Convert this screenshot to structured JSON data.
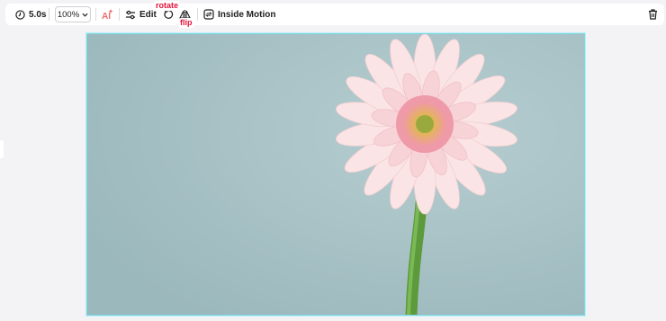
{
  "toolbar": {
    "duration_label": "5.0s",
    "zoom_value": "100%",
    "edit_label": "Edit",
    "rotate_tag": "rotate",
    "flip_tag": "flip",
    "inside_motion_label": "Inside Motion"
  },
  "icons": [
    "clock-icon",
    "chevron-down-icon",
    "ai-sparkle-icon",
    "sliders-icon",
    "rotate-icon",
    "flip-icon",
    "motion-icon",
    "trash-icon"
  ],
  "colors": {
    "accent_red": "#e4133a",
    "selection_border": "#7ad7e6",
    "canvas_bg": "#a8c3c6",
    "page_bg": "#f3f3f6"
  }
}
